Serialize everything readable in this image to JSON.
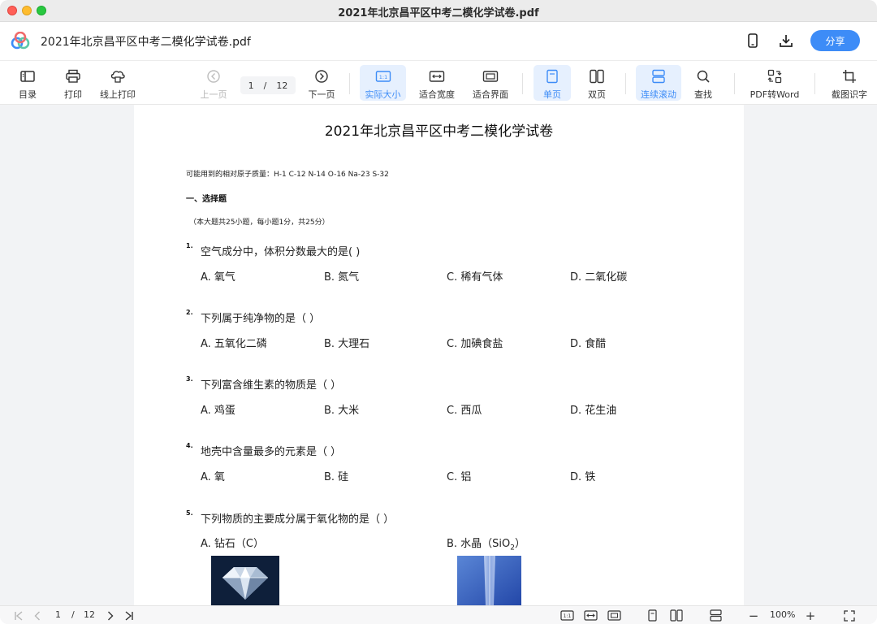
{
  "window": {
    "title": "2021年北京昌平区中考二模化学试卷.pdf"
  },
  "header": {
    "doc_title": "2021年北京昌平区中考二模化学试卷.pdf",
    "share_label": "分享",
    "icons": [
      "phone-icon",
      "download-icon"
    ]
  },
  "toolbar": {
    "toc": "目录",
    "print": "打印",
    "online_print": "线上打印",
    "prev": "上一页",
    "page_current": "1",
    "page_sep": "/",
    "page_total": "12",
    "next": "下一页",
    "actual_size": "实际大小",
    "fit_width": "适合宽度",
    "fit_page": "适合界面",
    "single": "单页",
    "double": "双页",
    "continuous": "连续滚动",
    "find": "查找",
    "pdf_to_word": "PDF转Word",
    "ocr": "截图识字",
    "actual_icon_text": "1:1"
  },
  "document": {
    "title": "2021年北京昌平区中考二模化学试卷",
    "atomic_masses": "可能用到的相对原子质量：H-1  C-12  N-14  O-16  Na-23  S-32",
    "section": "一、选择题",
    "section_note": "（本大题共25小题，每小题1分，共25分）",
    "questions": [
      {
        "num": "1.",
        "text": "空气成分中，体积分数最大的是(        )",
        "options": [
          "A. 氧气",
          "B. 氮气",
          "C. 稀有气体",
          "D. 二氧化碳"
        ]
      },
      {
        "num": "2.",
        "text": "下列属于纯净物的是（    ）",
        "options": [
          "A. 五氧化二磷",
          "B. 大理石",
          "C. 加碘食盐",
          "D. 食醋"
        ]
      },
      {
        "num": "3.",
        "text": "下列富含维生素的物质是（    ）",
        "options": [
          "A. 鸡蛋",
          "B. 大米",
          "C. 西瓜",
          "D. 花生油"
        ]
      },
      {
        "num": "4.",
        "text": "地壳中含量最多的元素是（    ）",
        "options": [
          "A. 氧",
          "B. 硅",
          "C. 铝",
          "D. 铁"
        ]
      },
      {
        "num": "5.",
        "text": "下列物质的主要成分属于氧化物的是（    ）",
        "options": [
          "A. 钻石（C）",
          "B. 水晶（SiO",
          "2",
          "）"
        ]
      }
    ]
  },
  "status": {
    "page_current": "1",
    "page_sep": "/",
    "page_total": "12",
    "zoom": "100%",
    "zoom_out": "−",
    "zoom_in": "+",
    "actual_icon_text": "1:1"
  },
  "colors": {
    "accent": "#3d8cf7",
    "active_bg": "#e6f0fe"
  }
}
